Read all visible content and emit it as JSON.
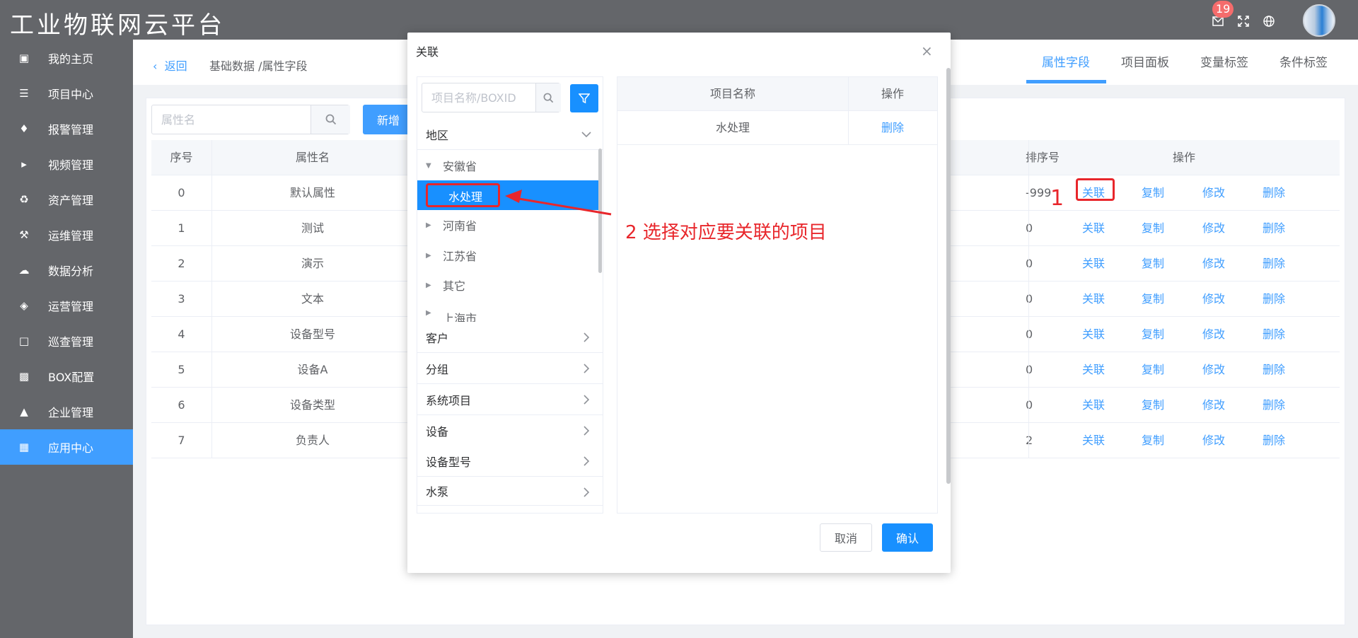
{
  "header": {
    "app_title": "工业物联网云平台",
    "notification_count": "19",
    "icons": [
      "mail-icon",
      "fullscreen-icon",
      "globe-icon"
    ]
  },
  "sidebar": {
    "items": [
      {
        "label": "我的主页",
        "icon": "laptop-icon"
      },
      {
        "label": "项目中心",
        "icon": "list-icon"
      },
      {
        "label": "报警管理",
        "icon": "bell-icon"
      },
      {
        "label": "视频管理",
        "icon": "video-camera-icon"
      },
      {
        "label": "资产管理",
        "icon": "recycle-icon"
      },
      {
        "label": "运维管理",
        "icon": "wrench-icon"
      },
      {
        "label": "数据分析",
        "icon": "cloud-chart-icon"
      },
      {
        "label": "运营管理",
        "icon": "cubes-icon"
      },
      {
        "label": "巡查管理",
        "icon": "document-icon"
      },
      {
        "label": "BOX配置",
        "icon": "monitor-icon"
      },
      {
        "label": "企业管理",
        "icon": "org-chart-icon"
      },
      {
        "label": "应用中心",
        "icon": "grid-icon"
      }
    ],
    "active_index": 11
  },
  "breadcrumb": {
    "back_label": "返回",
    "path": "基础数据 /属性字段"
  },
  "tabs": [
    {
      "label": "属性字段",
      "active": true
    },
    {
      "label": "项目面板",
      "active": false
    },
    {
      "label": "变量标签",
      "active": false
    },
    {
      "label": "条件标签",
      "active": false
    }
  ],
  "toolbar": {
    "search_placeholder": "属性名",
    "add_label": "新增"
  },
  "table": {
    "columns": [
      "序号",
      "属性名",
      "排序号",
      "操作"
    ],
    "actions": [
      "关联",
      "复制",
      "修改",
      "删除"
    ],
    "rows": [
      {
        "index": "0",
        "name": "默认属性",
        "sort": "-999"
      },
      {
        "index": "1",
        "name": "测试",
        "sort": "0"
      },
      {
        "index": "2",
        "name": "演示",
        "sort": "0"
      },
      {
        "index": "3",
        "name": "文本",
        "sort": "0"
      },
      {
        "index": "4",
        "name": "设备型号",
        "sort": "0"
      },
      {
        "index": "5",
        "name": "设备A",
        "sort": "0"
      },
      {
        "index": "6",
        "name": "设备类型",
        "sort": "0"
      },
      {
        "index": "7",
        "name": "负责人",
        "sort": "2"
      }
    ]
  },
  "annotations": {
    "step1": "1",
    "step2": "2 选择对应要关联的项目",
    "color": "#e8262b"
  },
  "modal": {
    "title": "关联",
    "search_placeholder": "项目名称/BOXID",
    "sections": [
      {
        "label": "地区",
        "expanded": true
      },
      {
        "label": "客户",
        "expanded": false
      },
      {
        "label": "分组",
        "expanded": false
      },
      {
        "label": "系统项目",
        "expanded": false
      },
      {
        "label": "设备",
        "expanded": false
      },
      {
        "label": "设备型号",
        "expanded": false
      },
      {
        "label": "水泵",
        "expanded": false
      }
    ],
    "tree": [
      {
        "label": "安徽省",
        "expanded": true
      },
      {
        "label": "水处理",
        "selected": true
      },
      {
        "label": "河南省",
        "expanded": false
      },
      {
        "label": "江苏省",
        "expanded": false
      },
      {
        "label": "其它",
        "expanded": false
      },
      {
        "label": "上海市",
        "expanded": false
      }
    ],
    "selected_table": {
      "columns": [
        "项目名称",
        "操作"
      ],
      "rows": [
        {
          "name": "水处理",
          "action": "删除"
        }
      ]
    },
    "cancel_label": "取消",
    "confirm_label": "确认"
  },
  "colors": {
    "primary": "#409eff",
    "sidebar_bg": "#64666a",
    "selected_bg": "#1890ff"
  }
}
